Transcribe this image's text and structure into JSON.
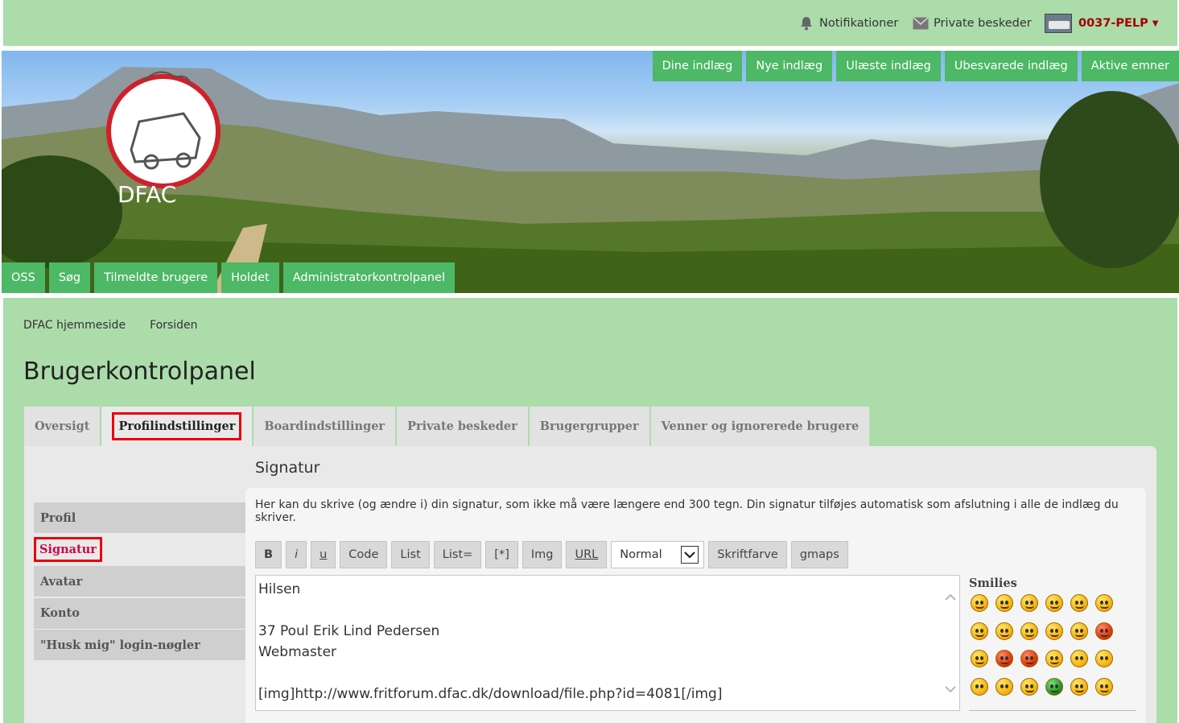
{
  "topbar": {
    "notifications": "Notifikationer",
    "messages": "Private beskeder",
    "username": "0037-PELP"
  },
  "banner": {
    "logo_text": "DFAC",
    "top_nav": [
      "Dine indlæg",
      "Nye indlæg",
      "Ulæste indlæg",
      "Ubesvarede indlæg",
      "Aktive emner"
    ],
    "bottom_nav": [
      "OSS",
      "Søg",
      "Tilmeldte brugere",
      "Holdet",
      "Administratorkontrolpanel"
    ]
  },
  "breadcrumb": [
    "DFAC hjemmeside",
    "Forsiden"
  ],
  "page_title": "Brugerkontrolpanel",
  "tabs": [
    "Oversigt",
    "Profilindstillinger",
    "Boardindstillinger",
    "Private beskeder",
    "Brugergrupper",
    "Venner og ignorerede brugere"
  ],
  "side_menu": [
    "Profil",
    "Signatur",
    "Avatar",
    "Konto",
    "\"Husk mig\" login-nøgler"
  ],
  "panel_title": "Signatur",
  "description": "Her kan du skrive (og ændre i) din signatur, som ikke må være længere end 300 tegn. Din signatur tilføjes automatisk som afslutning i alle de indlæg du skriver.",
  "toolbar": {
    "bold": "B",
    "italic": "i",
    "underline": "u",
    "code": "Code",
    "list": "List",
    "list_eq": "List=",
    "star": "[*]",
    "img": "Img",
    "url": "URL",
    "size_value": "Normal",
    "color": "Skriftfarve",
    "gmaps": "gmaps"
  },
  "signature_lines": [
    "Hilsen",
    "",
    "37 Poul Erik Lind Pedersen",
    "Webmaster",
    "",
    "[img]http://www.fritforum.dfac.dk/download/file.php?id=4081[/img]"
  ],
  "smilies_label": "Smilies",
  "colors": {
    "green_bg": "#addcab",
    "nav_button": "#4db865",
    "highlight": "#e8000b",
    "username": "#a30000"
  }
}
